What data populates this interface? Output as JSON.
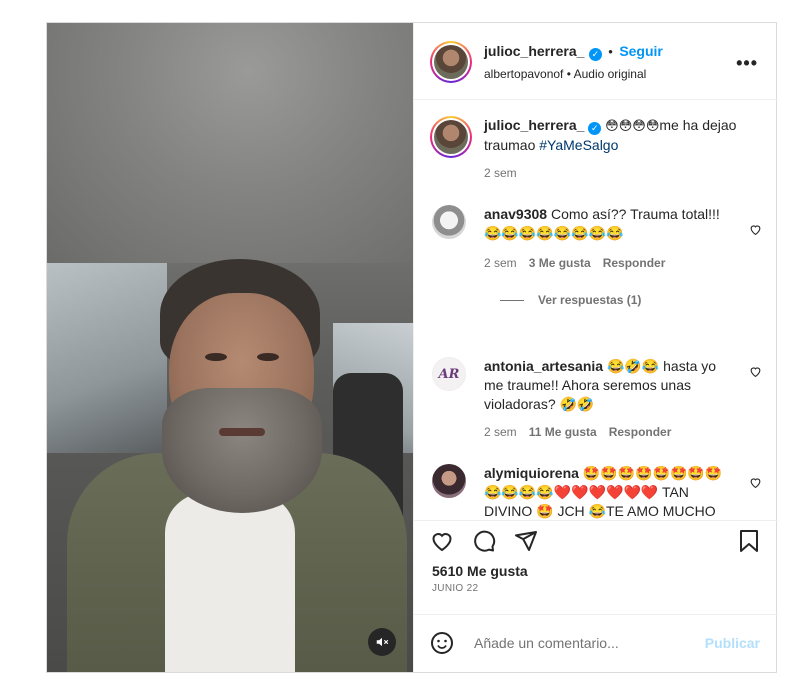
{
  "header": {
    "username": "julioc_herrera_",
    "separator": "•",
    "follow_label": "Seguir",
    "subline": "albertopavonof • Audio original",
    "more_icon": "more-horizontal-icon"
  },
  "caption": {
    "username": "julioc_herrera_",
    "emojis": "😳😳😳😳",
    "text": "me ha dejao traumao",
    "hashtag": "#YaMeSalgo",
    "time": "2 sem"
  },
  "comments": [
    {
      "username": "anav9308",
      "text": "Como así?? Trauma total!!! 😂😂😂😂😂😂😂😂",
      "time": "2 sem",
      "likes": "3 Me gusta",
      "reply": "Responder",
      "view_replies": "Ver respuestas (1)"
    },
    {
      "username": "antonia_artesania",
      "text": "😂🤣😂 hasta yo me traume!! Ahora seremos unas violadoras? 🤣🤣",
      "time": "2 sem",
      "likes": "11 Me gusta",
      "reply": "Responder"
    },
    {
      "username": "alymiquiorena",
      "text": "🤩🤩🤩🤩🤩🤩🤩🤩😂😂😂😂❤️❤️❤️❤️❤️❤️ TAN DIVINO 🤩 JCH 😂TE AMO MUCHO 😂😂😂😂 QUE"
    }
  ],
  "actions": {
    "likes": "5610 Me gusta",
    "date": "JUNIO 22"
  },
  "add_comment": {
    "placeholder": "Añade un comentario...",
    "publish": "Publicar"
  },
  "colors": {
    "accent": "#0095f6",
    "text": "#262626",
    "muted": "#737373",
    "border": "#dbdbdb"
  }
}
